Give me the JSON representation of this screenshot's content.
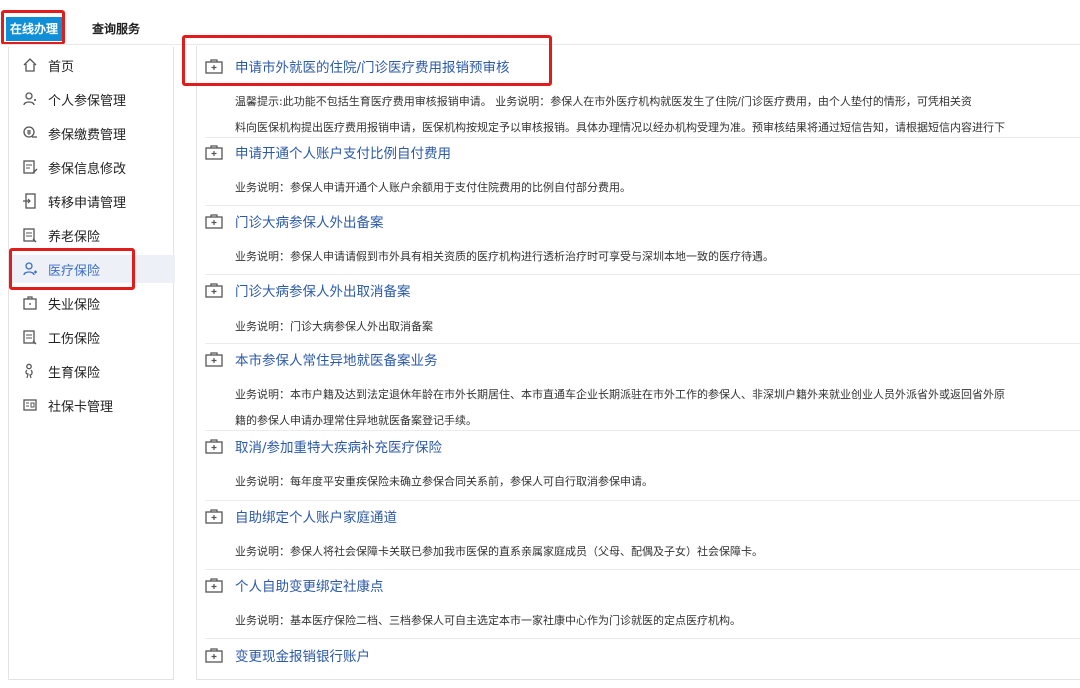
{
  "tabs": [
    {
      "label": "在线办理",
      "active": true
    },
    {
      "label": "查询服务",
      "active": false
    }
  ],
  "sidebar": {
    "items": [
      {
        "label": "首页",
        "icon": "home-icon"
      },
      {
        "label": "个人参保管理",
        "icon": "user-icon"
      },
      {
        "label": "参保缴费管理",
        "icon": "payment-icon"
      },
      {
        "label": "参保信息修改",
        "icon": "edit-icon"
      },
      {
        "label": "转移申请管理",
        "icon": "transfer-icon"
      },
      {
        "label": "养老保险",
        "icon": "document-icon"
      },
      {
        "label": "医疗保险",
        "icon": "medical-user-icon",
        "active": true
      },
      {
        "label": "失业保险",
        "icon": "briefcase-icon"
      },
      {
        "label": "工伤保险",
        "icon": "document-icon"
      },
      {
        "label": "生育保险",
        "icon": "maternity-icon"
      },
      {
        "label": "社保卡管理",
        "icon": "card-icon"
      }
    ]
  },
  "services": [
    {
      "title": "申请市外就医的住院/门诊医疗费用报销预审核",
      "desc": [
        "温馨提示:此功能不包括生育医疗费用审核报销申请。 业务说明：参保人在市外医疗机构就医发生了住院/门诊医疗费用，由个人垫付的情形，可凭相关资",
        "料向医保机构提出医疗费用报销申请，医保机构按规定予以审核报销。具体办理情况以经办机构受理为准。预审核结果将通过短信告知，请根据短信内容进行下"
      ]
    },
    {
      "title": "申请开通个人账户支付比例自付费用",
      "desc": [
        "业务说明：参保人申请开通个人账户余额用于支付住院费用的比例自付部分费用。"
      ]
    },
    {
      "title": "门诊大病参保人外出备案",
      "desc": [
        "业务说明：参保人申请请假到市外具有相关资质的医疗机构进行透析治疗时可享受与深圳本地一致的医疗待遇。"
      ]
    },
    {
      "title": "门诊大病参保人外出取消备案",
      "desc": [
        "业务说明：门诊大病参保人外出取消备案"
      ]
    },
    {
      "title": "本市参保人常住异地就医备案业务",
      "desc": [
        "业务说明：本市户籍及达到法定退休年龄在市外长期居住、本市直通车企业长期派驻在市外工作的参保人、非深圳户籍外来就业创业人员外派省外或返回省外原",
        "籍的参保人申请办理常住异地就医备案登记手续。"
      ]
    },
    {
      "title": "取消/参加重特大疾病补充医疗保险",
      "desc": [
        "业务说明：每年度平安重疾保险未确立参保合同关系前，参保人可自行取消参保申请。"
      ]
    },
    {
      "title": "自助绑定个人账户家庭通道",
      "desc": [
        "业务说明：参保人将社会保障卡关联已参加我市医保的直系亲属家庭成员（父母、配偶及子女）社会保障卡。"
      ]
    },
    {
      "title": "个人自助变更绑定社康点",
      "desc": [
        "业务说明：基本医疗保险二档、三档参保人可自主选定本市一家社康中心作为门诊就医的定点医疗机构。"
      ]
    },
    {
      "title": "变更现金报销银行账户",
      "desc": []
    }
  ],
  "colors": {
    "accent": "#0f8fd7",
    "link": "#2c5aa8",
    "highlight": "#e21b1b",
    "active_bg": "#eef0f8"
  }
}
